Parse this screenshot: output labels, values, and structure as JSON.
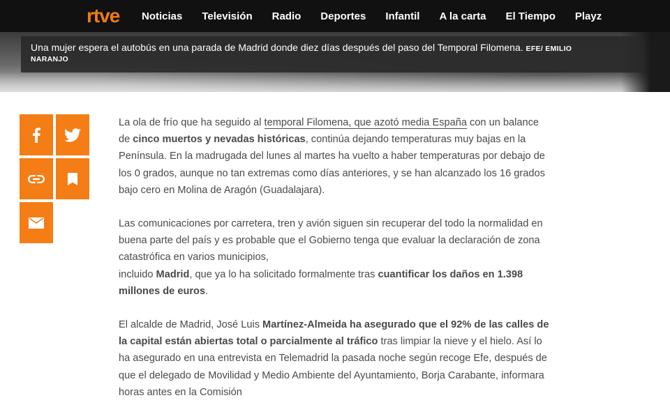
{
  "header": {
    "logo": "rtve",
    "nav": [
      "Noticias",
      "Televisión",
      "Radio",
      "Deportes",
      "Infantil",
      "A la carta",
      "El Tiempo",
      "Playz"
    ]
  },
  "hero": {
    "caption": "Una mujer espera el autobús en una parada de Madrid donde diez días después del paso del Temporal Filomena.",
    "credit_line1": "EFE/ EMILIO",
    "credit_line2": "NARANJO"
  },
  "share": {
    "buttons": [
      "facebook-icon",
      "twitter-icon",
      "link-icon",
      "bookmark-icon",
      "mail-icon"
    ]
  },
  "article": {
    "p1": {
      "a": "La ola de frío que ha seguido al ",
      "link": "temporal Filomena, que azotó media España",
      "b": " con un balance de ",
      "bold1": "cinco muertos y nevadas históricas",
      "c": ", continúa dejando temperaturas muy bajas en la Península. En la madrugada del lunes al martes ha vuelto a haber temperaturas por debajo de los 0 grados, aunque no tan extremas como días anteriores, y se han alcanzado los 16 grados bajo cero en Molina de Aragón (Guadalajara)."
    },
    "p2": {
      "a": "Las comunicaciones por carretera, tren y avión siguen sin recuperar del todo la normalidad en buena parte del país y es probable que el Gobierno tenga que evaluar la declaración de zona catastrófica en varios municipios,",
      "b": "incluido ",
      "bold1": "Madrid",
      "c": ", que ya lo ha solicitado formalmente tras ",
      "bold2": "cuantificar los daños en 1.398 millones de euros",
      "d": "."
    },
    "p3": {
      "a": "El alcalde de Madrid, José Luis ",
      "bold1": "Martínez-Almeida ha asegurado que el 92% de las calles de la capital están abiertas total o parcialmente al tráfico",
      "b": " tras limpiar la nieve y el hielo. Así lo ha asegurado en una entrevista en Telemadrid la pasada noche según recoge Efe, después de que el delegado de Movilidad y Medio Ambiente del Ayuntamiento, Borja Carabante, informara horas antes en la Comisión"
    }
  }
}
